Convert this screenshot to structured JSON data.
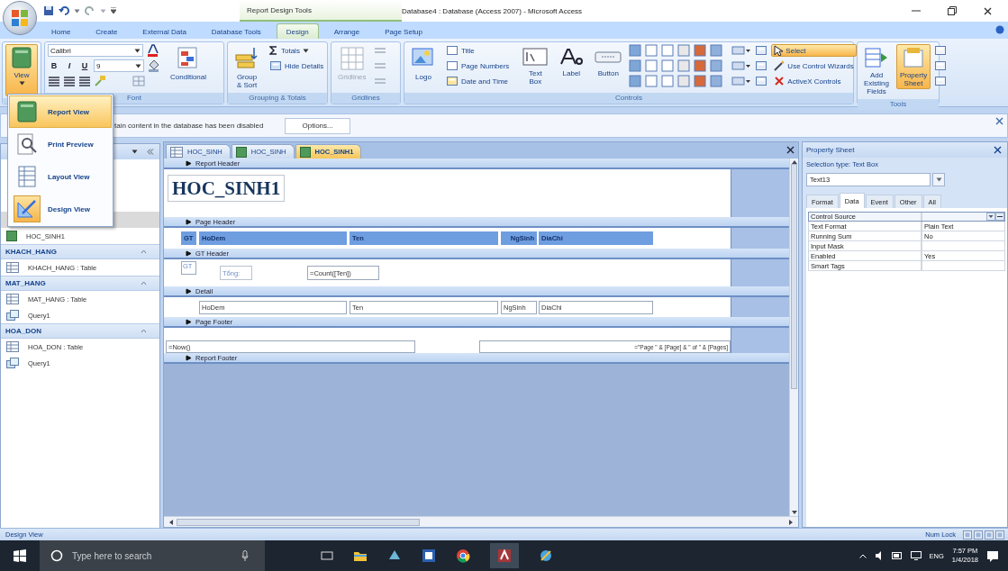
{
  "window": {
    "title": "Database4 : Database (Access 2007) - Microsoft Access",
    "context_tools": "Report Design Tools"
  },
  "ribbon_tabs": [
    {
      "label": "Home",
      "selected": false
    },
    {
      "label": "Create",
      "selected": false
    },
    {
      "label": "External Data",
      "selected": false
    },
    {
      "label": "Database Tools",
      "selected": false
    },
    {
      "label": "Design",
      "selected": true
    },
    {
      "label": "Arrange",
      "selected": false
    },
    {
      "label": "Page Setup",
      "selected": false
    }
  ],
  "ribbon": {
    "view": "View",
    "font": {
      "label": "Font",
      "font_name": "Calibri",
      "font_size": "9",
      "format_buttons": [
        "B",
        "I",
        "U"
      ],
      "conditional": "Conditional"
    },
    "grouping": {
      "label": "Grouping & Totals",
      "group_sort": "Group & Sort",
      "totals": "Totals",
      "hide_details": "Hide Details"
    },
    "gridlines": {
      "label": "Gridlines",
      "button": "Gridlines",
      "disabled": true
    },
    "controls": {
      "label": "Controls",
      "logo": "Logo",
      "title": "Title",
      "page_numbers": "Page Numbers",
      "date_time": "Date and Time",
      "text_box": "Text Box",
      "label_tool": "Label",
      "button": "Button",
      "select": {
        "label": "Select",
        "on": true
      },
      "wizards": "Use Control Wizards",
      "activex": "ActiveX Controls"
    },
    "tools": {
      "label": "Tools",
      "buttons": [
        {
          "label": "Add Existing Fields",
          "on": false
        },
        {
          "label": "Property Sheet",
          "on": true
        }
      ]
    }
  },
  "view_menu": {
    "open": true,
    "items": [
      {
        "label": "Report View",
        "kind": "report",
        "selected": true,
        "current": false
      },
      {
        "label": "Print Preview",
        "kind": "preview",
        "selected": false,
        "current": false
      },
      {
        "label": "Layout View",
        "kind": "layout",
        "selected": false,
        "current": false
      },
      {
        "label": "Design View",
        "kind": "design",
        "selected": false,
        "current": true
      }
    ]
  },
  "message_bar": {
    "text": "tain content in the database has been disabled",
    "button": "Options..."
  },
  "nav_pane": {
    "groups": [
      {
        "items": [
          {
            "kind": "report",
            "label": "HOC_SINH1"
          }
        ]
      },
      {
        "label": "KHACH_HANG",
        "items": [
          {
            "kind": "table",
            "label": "KHACH_HANG : Table"
          }
        ]
      },
      {
        "label": "MAT_HANG",
        "items": [
          {
            "kind": "table",
            "label": "MAT_HANG : Table"
          },
          {
            "kind": "query",
            "label": "Query1"
          }
        ]
      },
      {
        "label": "HOA_DON",
        "items": [
          {
            "kind": "table",
            "label": "HOA_DON : Table"
          },
          {
            "kind": "query",
            "label": "Query1"
          }
        ]
      }
    ]
  },
  "doc_tabs": [
    {
      "label": "HOC_SINH",
      "kind": "table",
      "selected": false
    },
    {
      "label": "HOC_SINH",
      "kind": "report",
      "selected": false
    },
    {
      "label": "HOC_SINH1",
      "kind": "report",
      "selected": true
    }
  ],
  "report_sections": [
    {
      "title": "Report Header",
      "controls": [
        {
          "kind": "title",
          "text": "HOC_SINH1"
        }
      ]
    },
    {
      "title": "Page Header",
      "controls": [
        {
          "kind": "heading",
          "text": "GT"
        },
        {
          "kind": "heading",
          "text": "HoDem"
        },
        {
          "kind": "heading",
          "text": "Ten"
        },
        {
          "kind": "heading_right",
          "text": "NgSinh"
        },
        {
          "kind": "heading",
          "text": "DiaChi"
        }
      ]
    },
    {
      "title": "GT Header",
      "controls": [
        {
          "kind": "textbox_small",
          "text": "GT"
        },
        {
          "kind": "label",
          "text": "Tổng:"
        },
        {
          "kind": "textbox",
          "text": "=Count([Ten])"
        }
      ]
    },
    {
      "title": "Detail",
      "controls": [
        {
          "kind": "textbox",
          "text": "HoDem"
        },
        {
          "kind": "textbox",
          "text": "Ten"
        },
        {
          "kind": "textbox",
          "text": "NgSinh"
        },
        {
          "kind": "textbox",
          "text": "DiaChi"
        }
      ]
    },
    {
      "title": "Page Footer",
      "controls": [
        {
          "kind": "textbox",
          "text": "=Now()"
        },
        {
          "kind": "textbox_right",
          "text": "=\"Page \" & [Page] & \" of \" & [Pages]"
        }
      ]
    },
    {
      "title": "Report Footer"
    }
  ],
  "property_sheet": {
    "title": "Property Sheet",
    "selection_type": "Selection type:  Text Box",
    "object": "Text13",
    "tabs": [
      {
        "label": "Format",
        "selected": false
      },
      {
        "label": "Data",
        "selected": true
      },
      {
        "label": "Event",
        "selected": false
      },
      {
        "label": "Other",
        "selected": false
      },
      {
        "label": "All",
        "selected": false
      }
    ],
    "rows": [
      {
        "name": "Control Source",
        "selected": true
      },
      {
        "name": "Text Format",
        "value": "Plain Text",
        "selected": false
      },
      {
        "name": "Running Sum",
        "value": "No",
        "selected": false
      },
      {
        "name": "Input Mask",
        "selected": false
      },
      {
        "name": "Enabled",
        "value": "Yes",
        "selected": false
      },
      {
        "name": "Smart Tags",
        "selected": false
      }
    ]
  },
  "status_bar": {
    "mode": "Design View",
    "indicator": "Num Lock"
  },
  "taskbar": {
    "search_placeholder": "Type here to search",
    "language": "ENG",
    "time": "7:57 PM",
    "date": "1/4/2018"
  }
}
